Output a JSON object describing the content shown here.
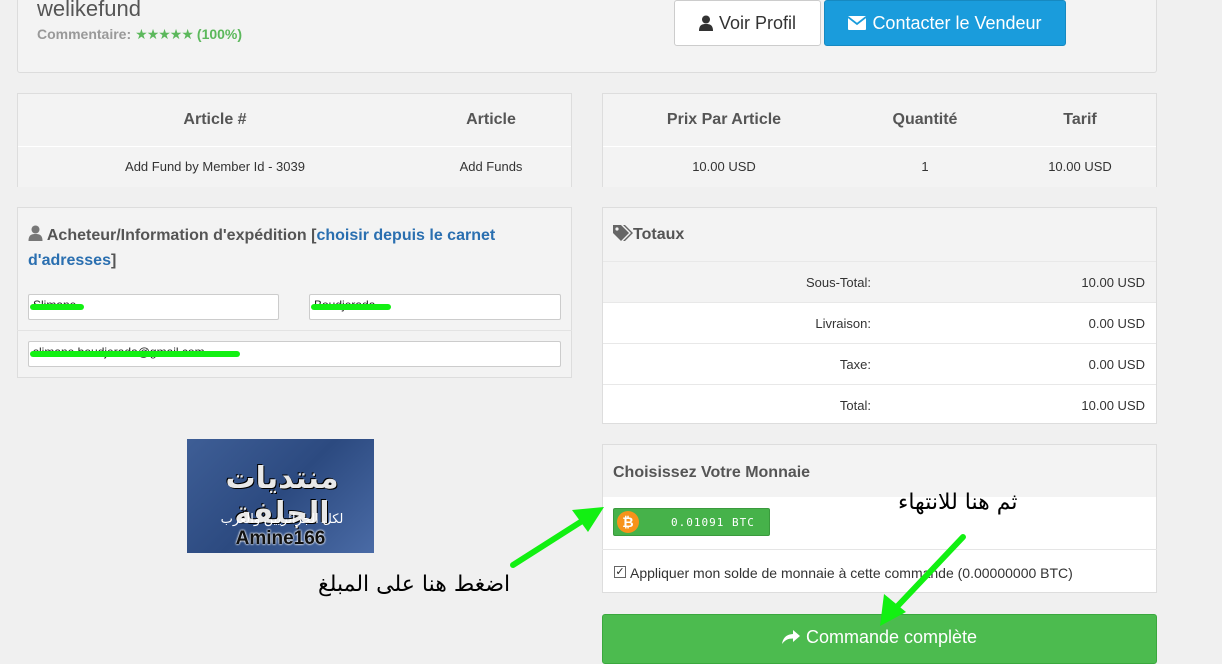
{
  "seller": {
    "name": "welikefund",
    "comment_label": "Commentaire:",
    "stars": "★★★★★",
    "rating": "(100%)",
    "profile_button": "Voir Profil",
    "contact_button": "Contacter le Vendeur"
  },
  "items_table": {
    "headers": [
      "Article #",
      "Article"
    ],
    "row": [
      "Add Fund by Member Id - 3039",
      "Add Funds"
    ]
  },
  "price_table": {
    "headers": [
      "Prix Par Article",
      "Quantité",
      "Tarif"
    ],
    "row": [
      "10.00 USD",
      "1",
      "10.00 USD"
    ]
  },
  "buyer": {
    "title": "Acheteur/Information d'expédition",
    "bracket_open": "[",
    "address_book_link": "choisir depuis le carnet d'adresses",
    "bracket_close": "]",
    "first_name": "Slimane",
    "last_name": "Boudjerada",
    "email": "slimane.boudjerada@gmail.com"
  },
  "logo": {
    "arabic_title": "منتديات الجلفة",
    "arabic_sub": "لكل الجزائريين والعرب",
    "signature": "Amine166"
  },
  "totals": {
    "title": "Totaux",
    "rows": [
      {
        "label": "Sous-Total:",
        "value": "10.00 USD"
      },
      {
        "label": "Livraison:",
        "value": "0.00 USD"
      },
      {
        "label": "Taxe:",
        "value": "0.00 USD"
      },
      {
        "label": "Total:",
        "value": "10.00 USD"
      }
    ]
  },
  "currency": {
    "title": "Choisissez Votre Monnaie",
    "btc_symbol": "₿",
    "btc_amount": "0.01091 BTC",
    "apply_balance": "Appliquer mon solde de monnaie à cette commande (0.00000000 BTC)",
    "apply_checked": true
  },
  "complete_button": "Commande complète",
  "annotations": {
    "click_amount": "اضغط هنا على المبلغ",
    "then_finish": "ثم هنا للانتهاء"
  },
  "colors": {
    "primary": "#1a9cdc",
    "success": "#4cbb4f",
    "stars": "#5cb85c",
    "link": "#2a6fb0",
    "annotation_arrow": "#12f012",
    "bitcoin": "#f7931a"
  }
}
